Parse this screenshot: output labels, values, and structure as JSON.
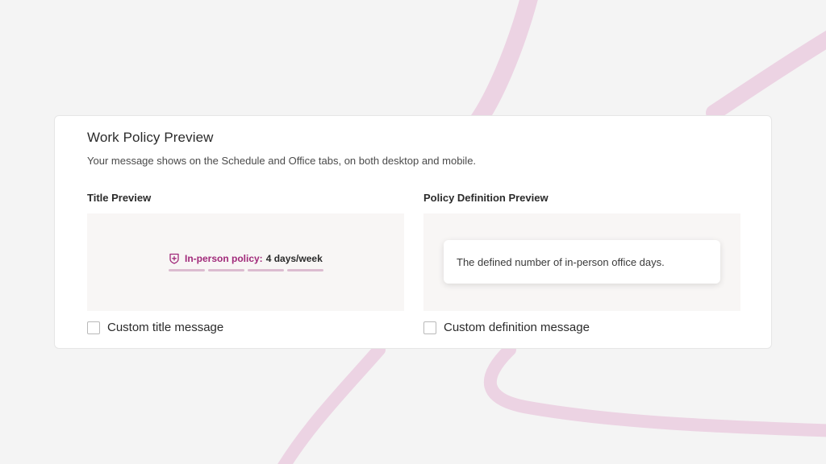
{
  "card": {
    "title": "Work Policy Preview",
    "subtitle": "Your message shows on the Schedule and Office tabs, on both desktop and mobile."
  },
  "title_preview": {
    "label": "Title Preview",
    "policy_label": "In-person policy:",
    "policy_value": "4 days/week",
    "days_per_week": 4,
    "icon": "shield-plus-icon",
    "accent_color": "#a12a7a",
    "bar_color": "#dcbcd0"
  },
  "definition_preview": {
    "label": "Policy Definition Preview",
    "tooltip_text": "The defined number of in-person office days."
  },
  "options": {
    "custom_title_label": "Custom title message",
    "custom_title_checked": false,
    "custom_definition_label": "Custom definition message",
    "custom_definition_checked": false
  },
  "colors": {
    "background": "#f4f4f4",
    "stroke": "#ecd3e3",
    "card": "#ffffff",
    "preview_bg": "#f8f6f5"
  }
}
